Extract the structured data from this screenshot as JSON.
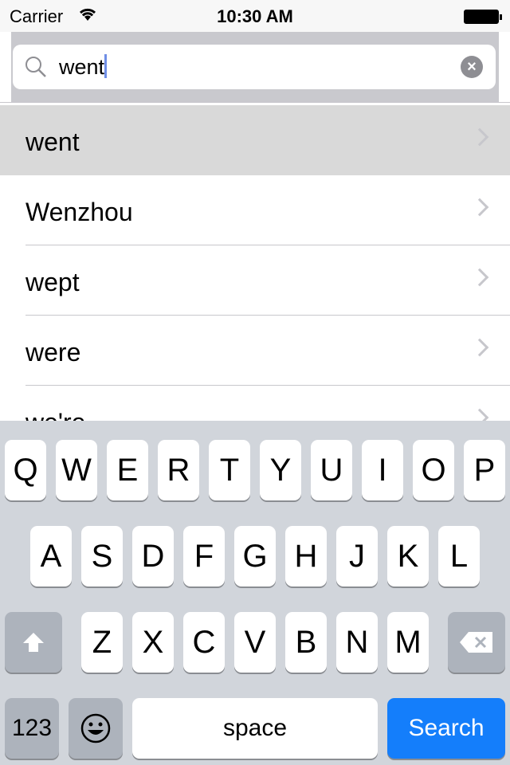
{
  "status": {
    "carrier": "Carrier",
    "time": "10:30 AM"
  },
  "search": {
    "query": "went"
  },
  "results": [
    "went",
    "Wenzhou",
    "wept",
    "were",
    "we're"
  ],
  "keyboard": {
    "row1": [
      "Q",
      "W",
      "E",
      "R",
      "T",
      "Y",
      "U",
      "I",
      "O",
      "P"
    ],
    "row2": [
      "A",
      "S",
      "D",
      "F",
      "G",
      "H",
      "J",
      "K",
      "L"
    ],
    "row3": [
      "Z",
      "X",
      "C",
      "V",
      "B",
      "N",
      "M"
    ],
    "numbers": "123",
    "space": "space",
    "search": "Search"
  },
  "colors": {
    "accent": "#147efb",
    "selected_row": "#d9d9d9",
    "keyboard_bg": "#d1d5db"
  }
}
